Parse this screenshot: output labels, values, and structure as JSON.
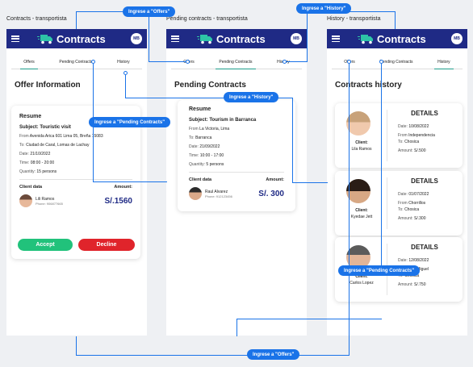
{
  "colors": {
    "appbar": "#1f2a85",
    "accept": "#21c27b",
    "decline": "#e0242b",
    "arrow": "#1a73e8",
    "tab_active": "#1f9d8b"
  },
  "screens": {
    "offers": {
      "title": "Contracts - transportista"
    },
    "pending": {
      "title": "Pending contracts - transportista"
    },
    "history": {
      "title": "History - transportista"
    }
  },
  "appbar": {
    "brand": "Contracts",
    "avatar": "MB"
  },
  "tabs": {
    "offers": "Offers",
    "pending": "Pending Contracts",
    "history": "History"
  },
  "offers": {
    "section_title": "Offer Information",
    "resume": "Resume",
    "subject": "Subject: Touristic visit",
    "from_label": "From",
    "from": "Avenida Arica 601 Lima 05, Breña 15083",
    "to_label": "To:",
    "to": "Ciudad de Caral, Lomas de Lachay",
    "date_label": "Date:",
    "date": "21/10/2022",
    "time_label": "Time:",
    "time": "08:00 - 20:00",
    "quantity_label": "Quantity:",
    "quantity": "15 persons",
    "client_label": "Client data",
    "amount_label": "Amount:",
    "client_name": "Lili Ramos",
    "client_phone": "Phone: 906877665",
    "amount": "S/.1560",
    "accept": "Accept",
    "decline": "Decline"
  },
  "pending": {
    "section_title": "Pending Contracts",
    "resume": "Resume",
    "subject": "Subject: Tourism in Barranca",
    "from_label": "From",
    "from": "La Victoria, Lima",
    "to_label": "To:",
    "to": "Barranca",
    "date_label": "Date:",
    "date": "21/09/2022",
    "time_label": "Time:",
    "time": "10:00 - 17:00",
    "quantity_label": "Quantity:",
    "quantity": "5 persons",
    "client_label": "Client data",
    "amount_label": "Amount:",
    "client_name": "Raul Alvarez",
    "client_phone": "Phone: 912123456",
    "amount": "S/. 300"
  },
  "history": {
    "section_title": "Contracts history",
    "details_label": "DETAILS",
    "client_label": "Client:",
    "date_label": "Date:",
    "from_label": "From",
    "to_label": "To:",
    "amount_label": "Amount:",
    "items": [
      {
        "client": "Lila Ramos",
        "date": "10/08/2022",
        "from": "Independencia",
        "to": "Chosica",
        "amount": "S/.500"
      },
      {
        "client": "Kyedae Jett",
        "date": "01/07/2022",
        "from": "Chorrillos",
        "to": "Chosica",
        "amount": "S/.300"
      },
      {
        "client": "Carlos Lopez",
        "date": "12/08/2022",
        "from": "San Miguel",
        "to": "Chosica",
        "amount": "S/.750"
      }
    ]
  },
  "annotations": {
    "to_offers_top": "Ingrese a \"Offers\"",
    "to_history_top": "Ingrese a \"History\"",
    "to_pending_left": "Ingrese a \"Pending Contracts\"",
    "to_history_mid": "Ingrese a \"History\"",
    "to_pending_right": "Ingrese a \"Pending Contracts\"",
    "to_offers_bottom": "Ingrese a \"Offers\""
  }
}
